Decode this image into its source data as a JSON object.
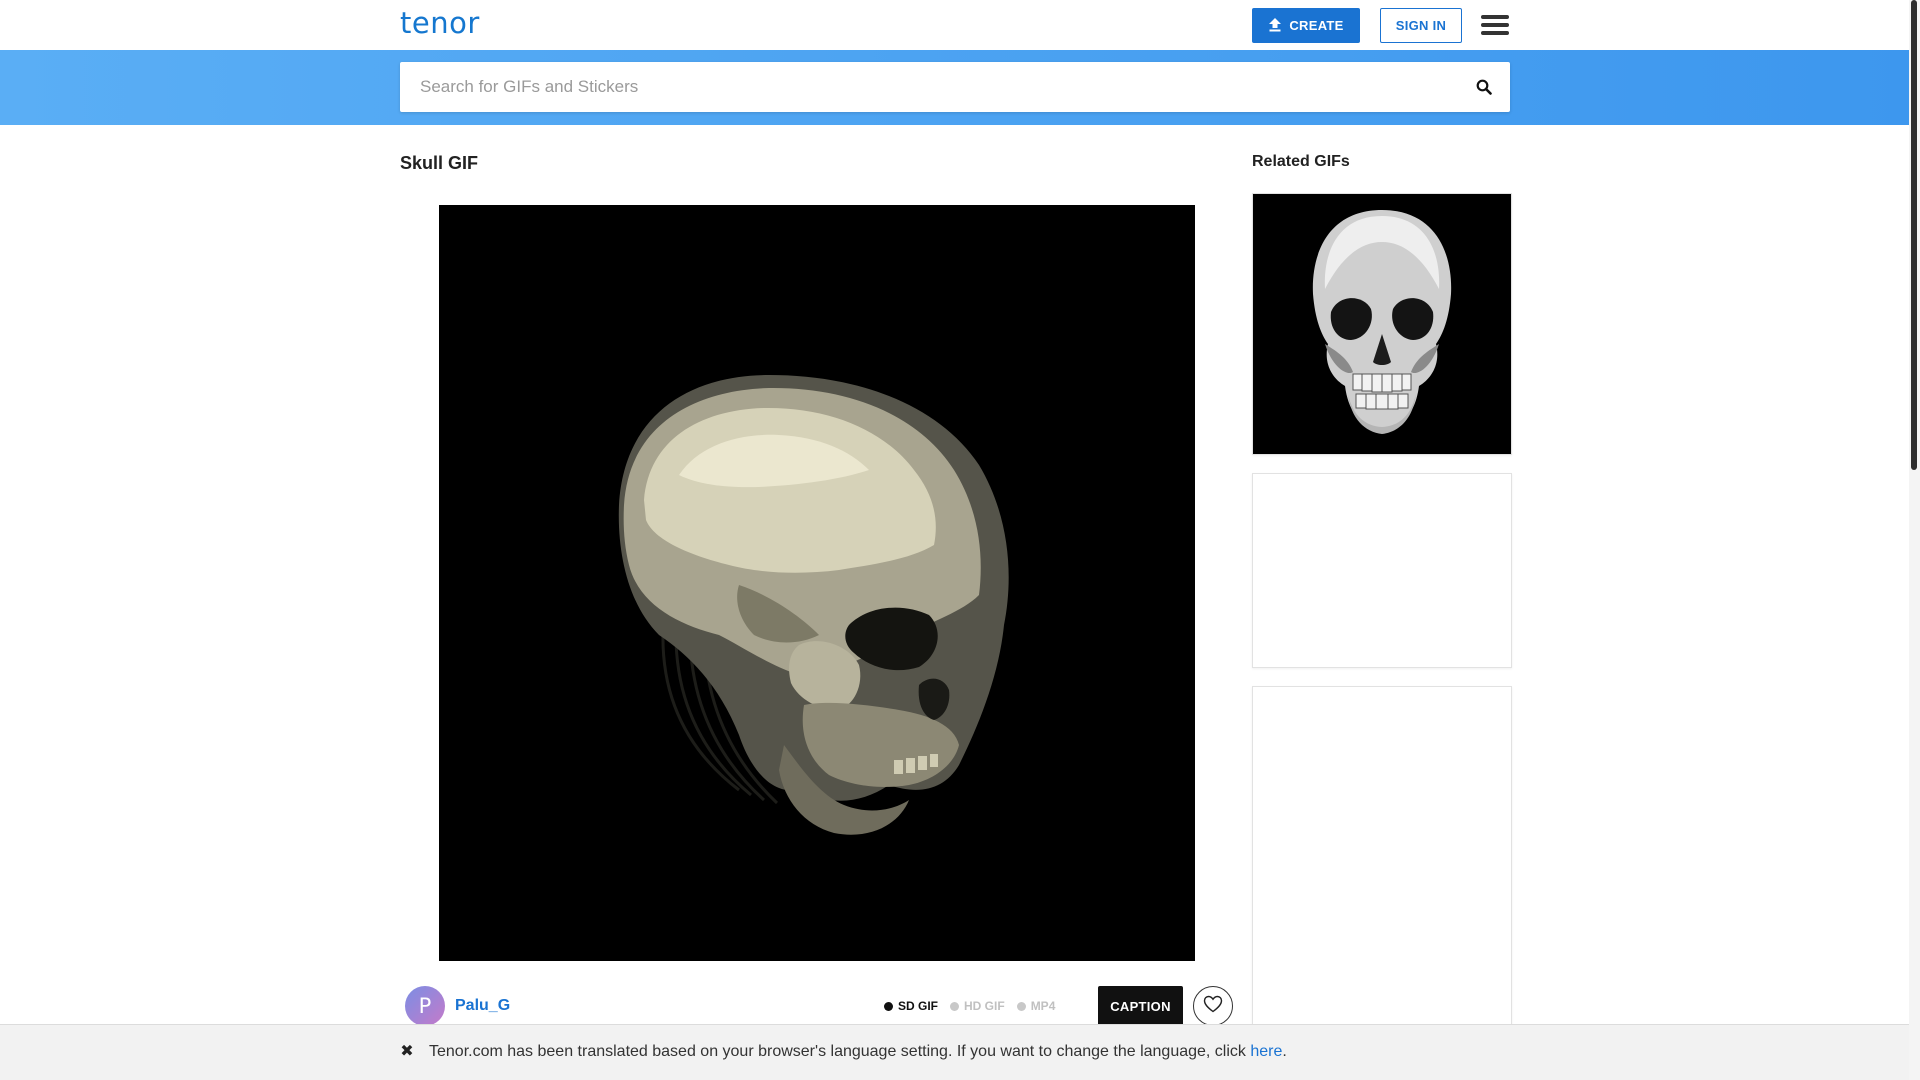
{
  "header": {
    "logo": "tenor",
    "create_label": "CREATE",
    "signin_label": "SIGN IN"
  },
  "search": {
    "placeholder": "Search for GIFs and Stickers"
  },
  "main": {
    "title": "Skull GIF",
    "author": {
      "initial": "P",
      "name": "Palu_G"
    },
    "formats": [
      {
        "label": "SD GIF",
        "active": true
      },
      {
        "label": "HD GIF",
        "active": false
      },
      {
        "label": "MP4",
        "active": false
      }
    ],
    "caption_label": "CAPTION"
  },
  "sidebar": {
    "title": "Related GIFs"
  },
  "notice": {
    "text": "Tenor.com has been translated based on your browser's language setting. If you want to change the language, click ",
    "link": "here",
    "suffix": "."
  },
  "colors": {
    "brand": "#1a73d2",
    "search_band_start": "#5aaef5",
    "search_band_end": "#3d97ee",
    "gif_background": "#000000"
  },
  "icons": {
    "create": "upload-arrow-icon",
    "menu": "hamburger-menu-icon",
    "search": "search-icon",
    "favorite": "heart-icon",
    "notice_close": "close-icon"
  }
}
